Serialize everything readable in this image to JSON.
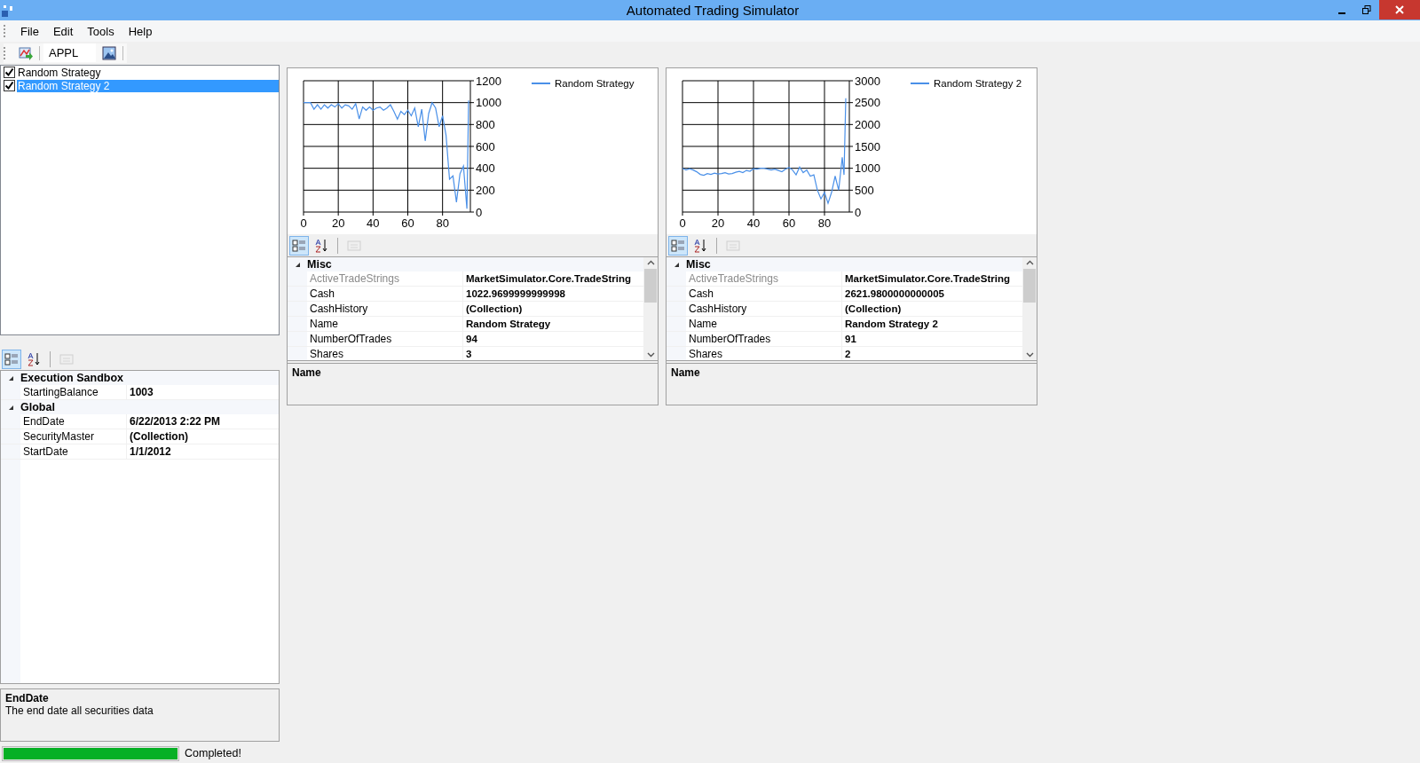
{
  "window": {
    "title": "Automated Trading Simulator"
  },
  "menu": [
    {
      "label": "File"
    },
    {
      "label": "Edit"
    },
    {
      "label": "Tools"
    },
    {
      "label": "Help"
    }
  ],
  "toolbar": {
    "symbol": "APPL"
  },
  "strategies": [
    {
      "label": "Random Strategy",
      "checked": true,
      "selected": false
    },
    {
      "label": "Random Strategy 2",
      "checked": true,
      "selected": true
    }
  ],
  "settings": {
    "view_buttons": [
      {
        "kind": "categorized",
        "selected": true,
        "disabled": false
      },
      {
        "kind": "alphabetical",
        "selected": false,
        "disabled": false
      },
      {
        "kind": "property_pages",
        "selected": false,
        "disabled": true
      }
    ],
    "categories": [
      {
        "name": "Execution Sandbox",
        "expanded": true,
        "rows": [
          {
            "name": "StartingBalance",
            "value": "1003",
            "readonly": false
          }
        ]
      },
      {
        "name": "Global",
        "expanded": true,
        "rows": [
          {
            "name": "EndDate",
            "value": "6/22/2013 2:22 PM",
            "readonly": false
          },
          {
            "name": "SecurityMaster",
            "value": "(Collection)",
            "readonly": false
          },
          {
            "name": "StartDate",
            "value": "1/1/2012",
            "readonly": false
          }
        ]
      }
    ],
    "description": {
      "title": "EndDate",
      "text": "The end date all securities data"
    }
  },
  "simulations": [
    {
      "chart_data": {
        "type": "line",
        "grid": true,
        "xlim": [
          0,
          96
        ],
        "ylim": [
          0,
          1200
        ],
        "xticks": [
          0,
          20,
          40,
          60,
          80
        ],
        "yticks": [
          0,
          200,
          400,
          600,
          800,
          1000,
          1200
        ],
        "x": [
          0,
          2,
          4,
          6,
          8,
          10,
          12,
          14,
          16,
          18,
          20,
          22,
          24,
          26,
          28,
          30,
          32,
          34,
          36,
          38,
          40,
          42,
          44,
          46,
          48,
          50,
          52,
          54,
          56,
          58,
          60,
          62,
          64,
          66,
          68,
          70,
          72,
          74,
          76,
          78,
          80,
          82,
          84,
          86,
          88,
          90,
          92,
          94,
          95
        ],
        "series": [
          {
            "name": "Random Strategy",
            "color": "#4a90e8",
            "values": [
              1000,
              1000,
              1000,
              940,
              980,
              940,
              980,
              950,
              980,
              960,
              990,
              950,
              980,
              970,
              940,
              990,
              850,
              960,
              930,
              960,
              930,
              950,
              960,
              930,
              950,
              980,
              920,
              850,
              920,
              890,
              930,
              880,
              950,
              780,
              940,
              650,
              900,
              1000,
              950,
              780,
              880,
              700,
              300,
              330,
              90,
              350,
              420,
              30,
              1020
            ]
          }
        ]
      },
      "view_buttons": [
        {
          "kind": "categorized",
          "selected": true,
          "disabled": false
        },
        {
          "kind": "alphabetical",
          "selected": false,
          "disabled": false
        },
        {
          "kind": "property_pages",
          "selected": false,
          "disabled": true
        }
      ],
      "categories": [
        {
          "name": "Misc",
          "expanded": true,
          "rows": [
            {
              "name": "ActiveTradeStrings",
              "value": "MarketSimulator.Core.TradeString",
              "readonly": true
            },
            {
              "name": "Cash",
              "value": "1022.9699999999998",
              "readonly": false
            },
            {
              "name": "CashHistory",
              "value": "(Collection)",
              "readonly": false
            },
            {
              "name": "Name",
              "value": "Random Strategy",
              "readonly": false
            },
            {
              "name": "NumberOfTrades",
              "value": "94",
              "readonly": false
            },
            {
              "name": "Shares",
              "value": "3",
              "readonly": false
            }
          ]
        }
      ],
      "description": {
        "title": "Name"
      }
    },
    {
      "chart_data": {
        "type": "line",
        "grid": true,
        "xlim": [
          0,
          94
        ],
        "ylim": [
          0,
          3000
        ],
        "xticks": [
          0,
          20,
          40,
          60,
          80
        ],
        "yticks": [
          0,
          500,
          1000,
          1500,
          2000,
          2500,
          3000
        ],
        "x": [
          0,
          2,
          4,
          6,
          8,
          10,
          12,
          14,
          16,
          18,
          20,
          22,
          24,
          26,
          28,
          30,
          32,
          34,
          36,
          38,
          40,
          42,
          44,
          46,
          48,
          50,
          52,
          54,
          56,
          58,
          60,
          62,
          64,
          66,
          68,
          70,
          72,
          74,
          76,
          78,
          80,
          82,
          84,
          86,
          88,
          90,
          91,
          92
        ],
        "series": [
          {
            "name": "Random Strategy 2",
            "color": "#4a90e8",
            "values": [
              1000,
              960,
              990,
              960,
              920,
              860,
              840,
              880,
              860,
              890,
              870,
              880,
              900,
              870,
              880,
              910,
              930,
              900,
              950,
              930,
              990,
              980,
              1000,
              1000,
              980,
              960,
              980,
              950,
              920,
              980,
              1020,
              960,
              850,
              1030,
              900,
              960,
              820,
              850,
              500,
              300,
              450,
              200,
              450,
              820,
              500,
              1250,
              850,
              2600
            ]
          }
        ]
      },
      "view_buttons": [
        {
          "kind": "categorized",
          "selected": true,
          "disabled": false
        },
        {
          "kind": "alphabetical",
          "selected": false,
          "disabled": false
        },
        {
          "kind": "property_pages",
          "selected": false,
          "disabled": true
        }
      ],
      "categories": [
        {
          "name": "Misc",
          "expanded": true,
          "rows": [
            {
              "name": "ActiveTradeStrings",
              "value": "MarketSimulator.Core.TradeString",
              "readonly": true
            },
            {
              "name": "Cash",
              "value": "2621.9800000000005",
              "readonly": false
            },
            {
              "name": "CashHistory",
              "value": "(Collection)",
              "readonly": false
            },
            {
              "name": "Name",
              "value": "Random Strategy 2",
              "readonly": false
            },
            {
              "name": "NumberOfTrades",
              "value": "91",
              "readonly": false
            },
            {
              "name": "Shares",
              "value": "2",
              "readonly": false
            }
          ]
        }
      ],
      "description": {
        "title": "Name"
      }
    }
  ],
  "status_bar": {
    "progress": {
      "level": 1
    },
    "text": "Completed!"
  }
}
